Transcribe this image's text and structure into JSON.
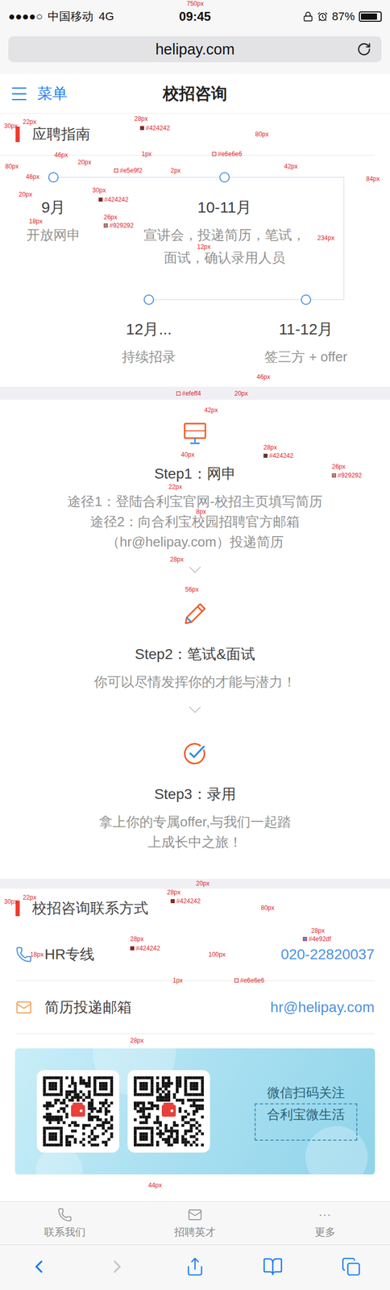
{
  "status_bar": {
    "signal": "●●●●○",
    "carrier": "中国移动",
    "network": "4G",
    "time": "09:45",
    "battery": "87%"
  },
  "browser": {
    "url": "helipay.com"
  },
  "nav": {
    "menu": "菜单",
    "title": "校招咨询"
  },
  "guide": {
    "title": "应聘指南",
    "timeline": [
      {
        "period": "9月",
        "lines": [
          "开放网申"
        ]
      },
      {
        "period": "10-11月",
        "lines": [
          "宣讲会，投递简历，笔试，",
          "面试，确认录用人员"
        ]
      },
      {
        "period": "12月...",
        "lines": [
          "持续招录"
        ]
      },
      {
        "period": "11-12月",
        "lines": [
          "签三方 + offer"
        ]
      }
    ]
  },
  "steps": [
    {
      "kind": "monitor",
      "title": "Step1：网申",
      "lines": [
        "途径1：登陆合利宝官网-校招主页填写简历",
        "途径2：向合利宝校园招聘官方邮箱",
        "（hr@helipay.com）投递简历"
      ]
    },
    {
      "kind": "pencil",
      "title": "Step2：笔试&面试",
      "lines": [
        "你可以尽情发挥你的才能与潜力！"
      ]
    },
    {
      "kind": "check",
      "title": "Step3：录用",
      "lines": [
        "拿上你的专属offer,与我们一起踏",
        "上成长中之旅！"
      ]
    }
  ],
  "contact": {
    "title": "校招咨询联系方式",
    "rows": [
      {
        "kind": "phone",
        "label": "HR专线",
        "value": "020-22820037"
      },
      {
        "kind": "mail",
        "label": "简历投递邮箱",
        "value": "hr@helipay.com"
      }
    ],
    "banner": {
      "lines": [
        "微信扫码关注",
        "合利宝微生活"
      ]
    }
  },
  "tab_bar": [
    {
      "kind": "phone",
      "label": "联系我们"
    },
    {
      "kind": "mail",
      "label": "招聘英才"
    },
    {
      "kind": "more",
      "glyph": "···",
      "label": "更多"
    }
  ],
  "annotations": [
    "750px",
    "30px",
    "22px",
    "28px",
    "#424242",
    "80px",
    "46px",
    "20px",
    "1px",
    "#e6e6e6",
    "80px",
    "46px",
    "#e5e9f2",
    "2px",
    "42px",
    "84px",
    "20px",
    "30px",
    "#424242",
    "18px",
    "26px",
    "#929292",
    "12px",
    "234px",
    "46px",
    "20px",
    "#efeff4",
    "42px",
    "40px",
    "28px",
    "#424242",
    "22px",
    "26px",
    "#929292",
    "8px",
    "28px",
    "56px",
    "20px",
    "30px",
    "22px",
    "28px",
    "#424242",
    "80px",
    "28px",
    "#424242",
    "28px",
    "#4e92df",
    "100px",
    "18px",
    "1px",
    "#e6e6e6",
    "28px",
    "44px"
  ]
}
